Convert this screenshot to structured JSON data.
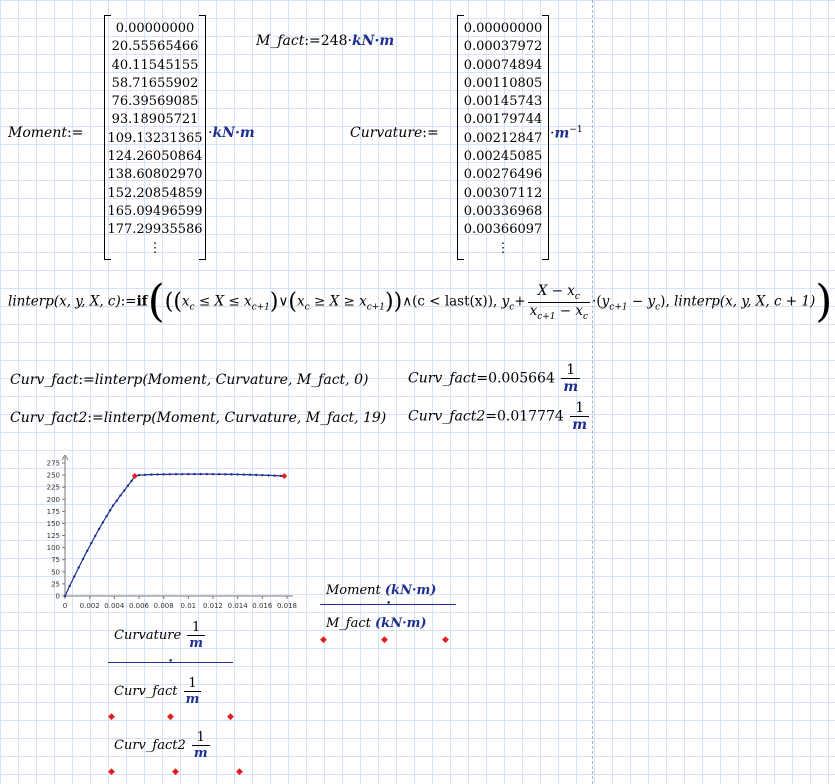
{
  "moment": {
    "label": "Moment",
    "assign": ":=",
    "values": [
      "0.00000000",
      "20.55565466",
      "40.11545155",
      "58.71655902",
      "76.39569085",
      "93.18905721",
      "109.13231365",
      "124.26050864",
      "138.60802970",
      "152.20854859",
      "165.09496599",
      "177.29935586",
      "⋮"
    ],
    "unit_dot": "·",
    "unit": "kN·m"
  },
  "m_fact": {
    "label": "M_fact",
    "assign": ":=",
    "value": "248",
    "unit_dot": "·",
    "unit": "kN·m"
  },
  "curvature": {
    "label": "Curvature",
    "assign": ":=",
    "values": [
      "0.00000000",
      "0.00037972",
      "0.00074894",
      "0.00110805",
      "0.00145743",
      "0.00179744",
      "0.00212847",
      "0.00245085",
      "0.00276496",
      "0.00307112",
      "0.00336968",
      "0.00366097",
      "⋮"
    ],
    "unit_dot": "·",
    "unit": "m",
    "unit_exp": "−1"
  },
  "linterp": {
    "lhs": "linterp",
    "args": "(x, y, X, c)",
    "assign": ":=",
    "if_kw": "if",
    "cond_a_lhs": "x",
    "cond_a_rel1": " ≤ X ≤ ",
    "cond_b_lhs": "x",
    "cond_b_rel1": " ≥ X ≥ ",
    "or_sym": "∨",
    "and_sym": "∧",
    "last_part": "c < last(x)",
    "sub_c": "c",
    "sub_c1": "c+1",
    "y_var": "y",
    "plus": "+",
    "frac_num": "X − x",
    "frac_den": "x",
    "den_minus": " − x",
    "times": "·",
    "y_diff": "y",
    "y_diff_minus": " − y",
    "recursive_call": "linterp(x, y, X, c + 1)"
  },
  "calcs": [
    {
      "lhs": "Curv_fact",
      "assign": ":=",
      "rhs": "linterp(Moment, Curvature, M_fact, 0)",
      "res_label": "Curv_fact",
      "res_eq": "=",
      "res_value": "0.005664",
      "res_num": "1",
      "res_den": "m"
    },
    {
      "lhs": "Curv_fact2",
      "assign": ":=",
      "rhs": "linterp(Moment, Curvature, M_fact, 19)",
      "res_label": "Curv_fact2",
      "res_eq": "=",
      "res_value": "0.017774",
      "res_num": "1",
      "res_den": "m"
    }
  ],
  "chart_data": {
    "type": "line",
    "xlim": [
      0,
      0.018
    ],
    "ylim": [
      0,
      275
    ],
    "x_ticks": [
      "0",
      "0.002",
      "0.004",
      "0.006",
      "0.008",
      "0.01",
      "0.012",
      "0.014",
      "0.016",
      "0.018"
    ],
    "y_ticks": [
      "0",
      "25",
      "50",
      "75",
      "100",
      "125",
      "150",
      "175",
      "200",
      "225",
      "250",
      "275"
    ],
    "grid": false,
    "series": [
      {
        "x": [
          0,
          0.00037972,
          0.00074894,
          0.00110805,
          0.00145743,
          0.00179744,
          0.00212847,
          0.00245085,
          0.00276496,
          0.00307112,
          0.00336968,
          0.00366097,
          0.0039,
          0.0042,
          0.0045,
          0.0048,
          0.0051,
          0.0054,
          0.00566,
          0.006,
          0.0065,
          0.007,
          0.0075,
          0.008,
          0.0085,
          0.009,
          0.0095,
          0.01,
          0.0105,
          0.011,
          0.0115,
          0.012,
          0.0125,
          0.013,
          0.0135,
          0.014,
          0.0145,
          0.015,
          0.0155,
          0.016,
          0.0165,
          0.017,
          0.0175,
          0.01777
        ],
        "y": [
          0,
          20.56,
          40.12,
          58.72,
          76.4,
          93.19,
          109.13,
          124.26,
          138.61,
          152.21,
          165.09,
          177.3,
          187,
          197,
          208,
          218,
          228,
          238,
          248,
          250,
          250.5,
          251,
          251.3,
          251.5,
          251.7,
          251.8,
          251.9,
          252,
          252,
          252,
          252,
          251.9,
          251.8,
          251.7,
          251.5,
          251.3,
          251,
          250.7,
          250.3,
          249.9,
          249.4,
          248.9,
          248.4,
          248
        ],
        "color": "#1f2f8f"
      },
      {
        "x": [
          0.005664,
          0.017774
        ],
        "y": [
          248,
          248
        ],
        "color": "#e02020",
        "marker_only": true
      }
    ]
  },
  "legend": {
    "y1_label": "Moment",
    "y1_unit": "(kN·m)",
    "y2_label": "M_fact",
    "y2_unit": "(kN·m)",
    "x1_label": "Curvature",
    "x2_label": "Curv_fact",
    "x3_label": "Curv_fact2",
    "frac_num": "1",
    "frac_den": "m"
  }
}
